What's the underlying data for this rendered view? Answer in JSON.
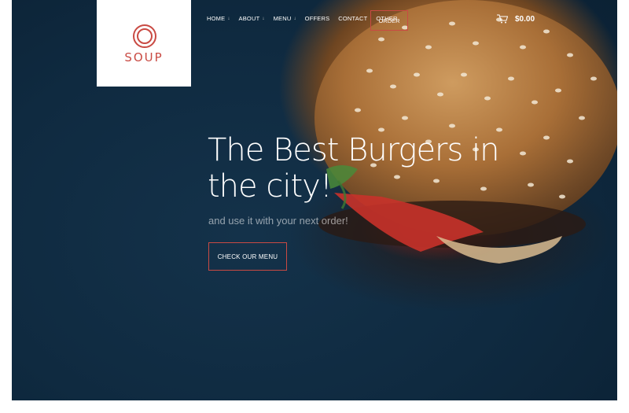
{
  "brand": {
    "name": "SOUP",
    "accent_color": "#c94a43"
  },
  "nav": {
    "items": [
      {
        "label": "HOME",
        "has_dropdown": true
      },
      {
        "label": "ABOUT",
        "has_dropdown": true
      },
      {
        "label": "MENU",
        "has_dropdown": true
      },
      {
        "label": "OFFERS",
        "has_dropdown": false
      },
      {
        "label": "CONTACT",
        "has_dropdown": false
      },
      {
        "label": "OTHER",
        "has_dropdown": false
      }
    ],
    "order_label": "ORDER",
    "cart_icon": "cart-icon",
    "cart_total": "$0.00"
  },
  "hero": {
    "headline": "The Best Burgers in the city!",
    "subtext": "and use it with your next order!",
    "cta_label": "CHECK OUR MENU"
  }
}
